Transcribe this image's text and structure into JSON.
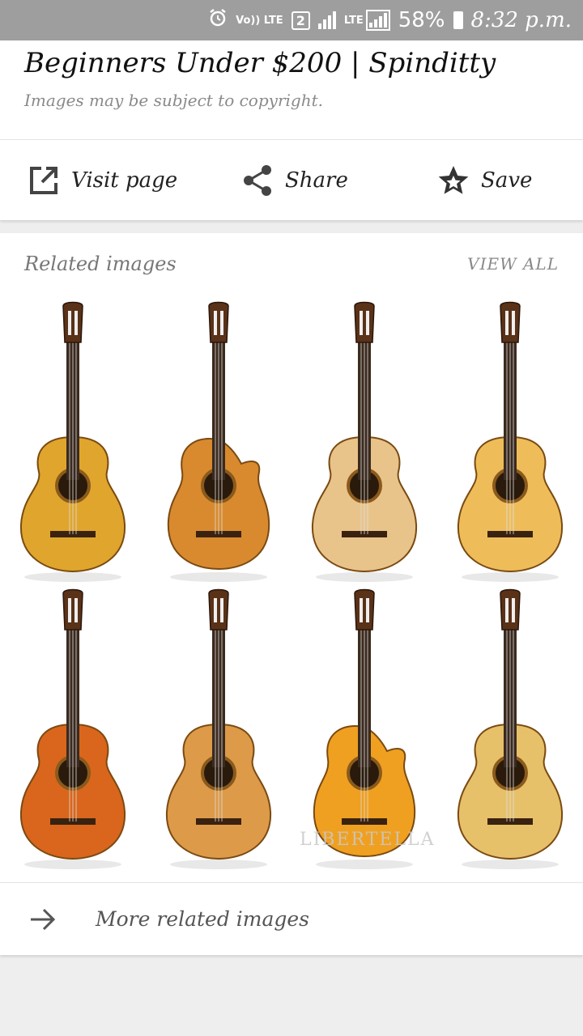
{
  "status_bar": {
    "volte_label": "Vo)) LTE",
    "sim_badge": "2",
    "lte_label": "LTE",
    "battery": "58%",
    "time": "8:32 p.m."
  },
  "result": {
    "title": "Beginners Under $200 | Spinditty",
    "copyright_note": "Images may be subject to copyright."
  },
  "actions": {
    "visit": "Visit page",
    "share": "Share",
    "save": "Save"
  },
  "related": {
    "heading": "Related images",
    "view_all": "VIEW ALL",
    "watermark": "LIBERTELLA",
    "more": "More related images",
    "thumbnails": [
      {
        "body_color": "#e0a52c",
        "cutaway": false
      },
      {
        "body_color": "#d98a2e",
        "cutaway": true
      },
      {
        "body_color": "#e9c48a",
        "cutaway": false
      },
      {
        "body_color": "#eebd5a",
        "cutaway": false
      },
      {
        "body_color": "#d9661c",
        "cutaway": false
      },
      {
        "body_color": "#dd9a48",
        "cutaway": false
      },
      {
        "body_color": "#f0a020",
        "cutaway": true
      },
      {
        "body_color": "#e7c06a",
        "cutaway": false
      }
    ]
  }
}
